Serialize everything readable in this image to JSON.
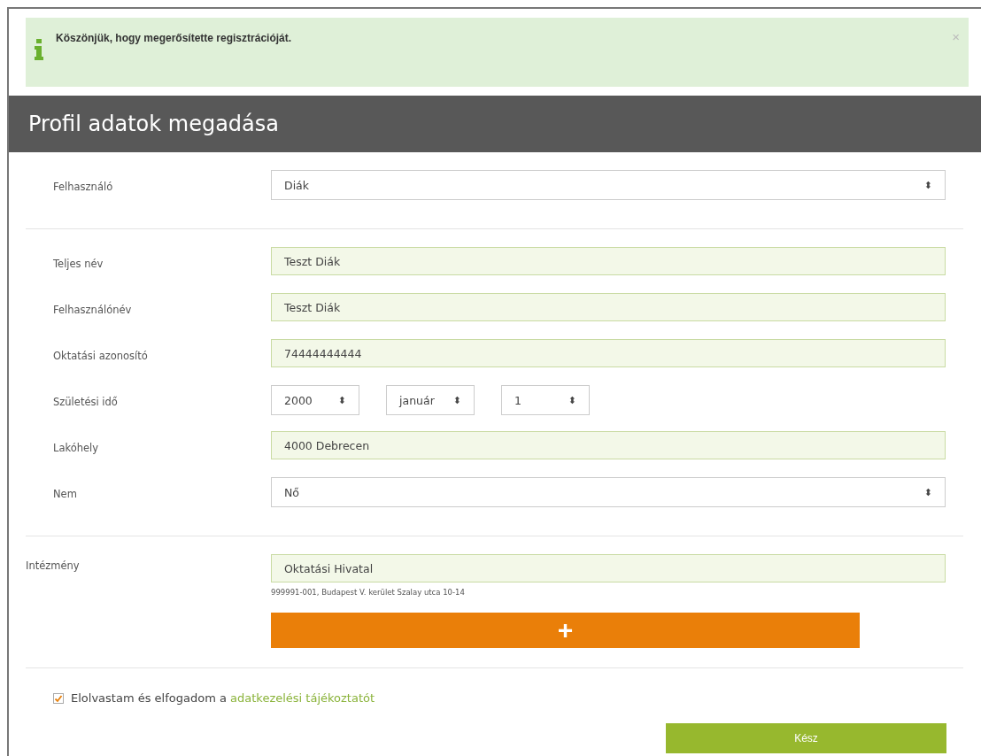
{
  "alert": {
    "message": "Köszönjük, hogy megerősítette regisztrációját.",
    "close": "×"
  },
  "header": {
    "title": "Profil adatok megadása"
  },
  "sections": [
    {
      "rows": [
        {
          "kind": "select",
          "label": "Felhasználó",
          "value": "Diák",
          "arrow": "⬍"
        }
      ]
    },
    {
      "rows": [
        {
          "kind": "text",
          "label": "Teljes név",
          "value": "Teszt Diák"
        },
        {
          "kind": "text",
          "label": "Felhasználónév",
          "value": "Teszt Diák"
        },
        {
          "kind": "text",
          "label": "Oktatási azonosító",
          "value": "74444444444"
        },
        {
          "kind": "date",
          "label": "Születési idő",
          "parts": [
            {
              "value": "2000",
              "arrow": "⬍"
            },
            {
              "value": "január",
              "arrow": "⬍"
            },
            {
              "value": "1",
              "arrow": "⬍"
            }
          ]
        },
        {
          "kind": "text",
          "label": "Lakóhely",
          "value": "4000 Debrecen"
        },
        {
          "kind": "select",
          "label": "Nem",
          "value": "Nő",
          "arrow": "⬍"
        }
      ]
    },
    {
      "rows": [
        {
          "kind": "institution",
          "label": "Intézmény",
          "value": "Oktatási Hivatal",
          "note": "999991-001, Budapest V. kerület Szalay utca 10-14",
          "add": "+"
        }
      ]
    }
  ],
  "consent": {
    "checked": true,
    "text": "Elolvastam és elfogadom a",
    "link": "adatkezelési tájékoztatót"
  },
  "submit": "Kész"
}
